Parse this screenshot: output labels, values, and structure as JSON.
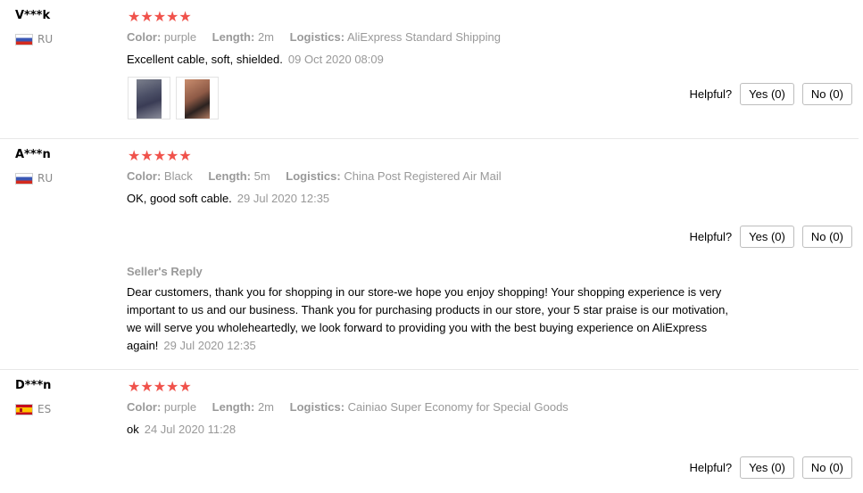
{
  "reviews": [
    {
      "user": "V***k",
      "country": "RU",
      "stars": "★★★★★",
      "attrs": [
        {
          "label": "Color:",
          "value": "purple"
        },
        {
          "label": "Length:",
          "value": "2m"
        },
        {
          "label": "Logistics:",
          "value": "AliExpress Standard Shipping"
        }
      ],
      "text": "Excellent cable, soft, shielded.",
      "date": "09 Oct 2020 08:09",
      "helpful_label": "Helpful?",
      "yes_label": "Yes (0)",
      "no_label": "No (0)"
    },
    {
      "user": "A***n",
      "country": "RU",
      "stars": "★★★★★",
      "attrs": [
        {
          "label": "Color:",
          "value": "Black"
        },
        {
          "label": "Length:",
          "value": "5m"
        },
        {
          "label": "Logistics:",
          "value": "China Post Registered Air Mail"
        }
      ],
      "text": "OK, good soft cable.",
      "date": "29 Jul 2020 12:35",
      "helpful_label": "Helpful?",
      "yes_label": "Yes (0)",
      "no_label": "No (0)",
      "seller_reply": {
        "title": "Seller's Reply",
        "text": "Dear customers, thank you for shopping in our store-we hope you enjoy shopping! Your shopping experience is very important to us and our business. Thank you for purchasing products in our store, your 5 star praise is our motivation, we will serve you wholeheartedly, we look forward to providing you with the best buying experience on AliExpress again!",
        "date": "29 Jul 2020 12:35"
      }
    },
    {
      "user": "D***n",
      "country": "ES",
      "stars": "★★★★★",
      "attrs": [
        {
          "label": "Color:",
          "value": "purple"
        },
        {
          "label": "Length:",
          "value": "2m"
        },
        {
          "label": "Logistics:",
          "value": "Cainiao Super Economy for Special Goods"
        }
      ],
      "text": "ok",
      "date": "24 Jul 2020 11:28",
      "helpful_label": "Helpful?",
      "yes_label": "Yes (0)",
      "no_label": "No (0)"
    }
  ],
  "colors": {
    "star": "#f0524b",
    "muted": "#999999",
    "border": "#e8e8e8"
  }
}
